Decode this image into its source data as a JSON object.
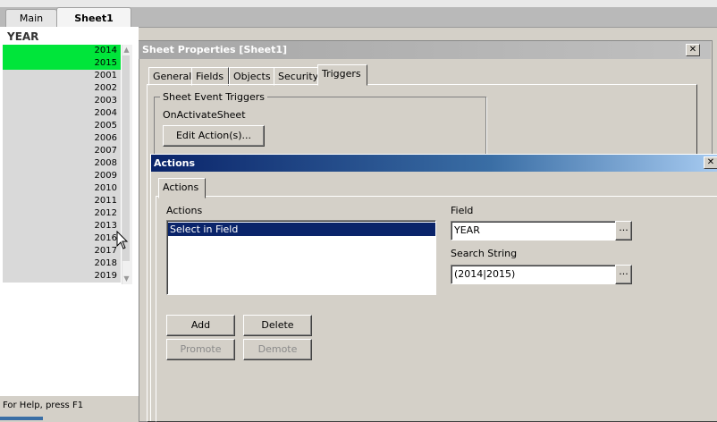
{
  "sheet_tabs": [
    {
      "label": "Main"
    },
    {
      "label": "Sheet1"
    }
  ],
  "listbox": {
    "title": "YEAR",
    "items": [
      {
        "label": "2014",
        "selected": true
      },
      {
        "label": "2015",
        "selected": true
      },
      {
        "label": "2001",
        "selected": false
      },
      {
        "label": "2002",
        "selected": false
      },
      {
        "label": "2003",
        "selected": false
      },
      {
        "label": "2004",
        "selected": false
      },
      {
        "label": "2005",
        "selected": false
      },
      {
        "label": "2006",
        "selected": false
      },
      {
        "label": "2007",
        "selected": false
      },
      {
        "label": "2008",
        "selected": false
      },
      {
        "label": "2009",
        "selected": false
      },
      {
        "label": "2010",
        "selected": false
      },
      {
        "label": "2011",
        "selected": false
      },
      {
        "label": "2012",
        "selected": false
      },
      {
        "label": "2013",
        "selected": false
      },
      {
        "label": "2016",
        "selected": false
      },
      {
        "label": "2017",
        "selected": false
      },
      {
        "label": "2018",
        "selected": false
      },
      {
        "label": "2019",
        "selected": false
      }
    ],
    "selected_color": "#00e53a",
    "unselected_color": "#d9d9d9"
  },
  "status_bar": {
    "text": "For Help, press F1"
  },
  "sheet_properties": {
    "title": "Sheet Properties [Sheet1]",
    "close_glyph": "✕",
    "tabs": [
      {
        "label": "General"
      },
      {
        "label": "Fields"
      },
      {
        "label": "Objects"
      },
      {
        "label": "Security"
      },
      {
        "label": "Triggers"
      }
    ],
    "active_tab": "Triggers",
    "group_label": "Sheet Event Triggers",
    "event_label": "OnActivateSheet",
    "edit_button": "Edit Action(s)..."
  },
  "actions_dialog": {
    "title": "Actions",
    "close_glyph": "✕",
    "tab_label": "Actions",
    "actions_label": "Actions",
    "actions_list": [
      "Select in Field"
    ],
    "field_label": "Field",
    "field_value": "YEAR",
    "search_label": "Search String",
    "search_value": "(2014|2015)",
    "browse_glyph": "...",
    "buttons": {
      "add": "Add",
      "delete": "Delete",
      "promote": "Promote",
      "demote": "Demote"
    },
    "title_gradient": [
      "#0a246a",
      "#a6caf0"
    ]
  }
}
